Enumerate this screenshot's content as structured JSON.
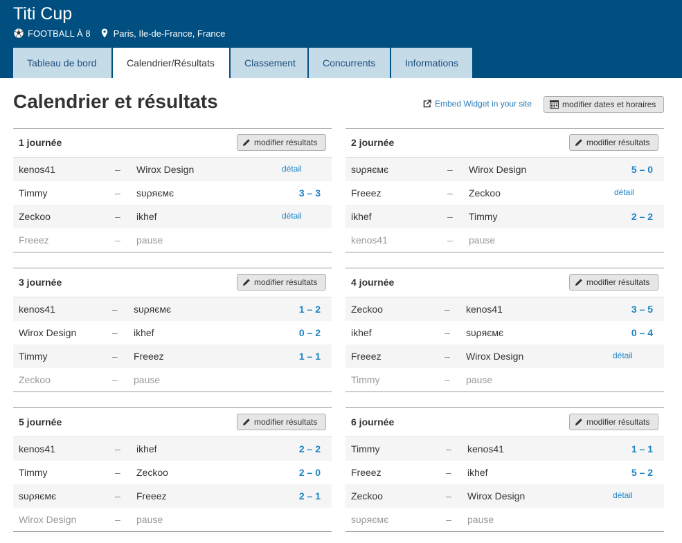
{
  "header": {
    "title": "Titi Cup",
    "sport": "FOOTBALL À 8",
    "location": "Paris, Ile-de-France, France"
  },
  "tabs": [
    {
      "label": "Tableau de bord"
    },
    {
      "label": "Calendrier/Résultats"
    },
    {
      "label": "Classement"
    },
    {
      "label": "Concurrents"
    },
    {
      "label": "Informations"
    }
  ],
  "page": {
    "title": "Calendrier et résultats",
    "embed_label": "Embed Widget in your site",
    "dates_button": "modifier dates et horaires"
  },
  "round_button": "modifier résultats",
  "rounds": [
    {
      "title": "1 journée",
      "matches": [
        {
          "home": "kenos41",
          "dash": "–",
          "away": "Wirox Design",
          "score": "",
          "detail": "détail"
        },
        {
          "home": "Timmy",
          "dash": "–",
          "away": "ѕυρяємє",
          "score": "3 – 3",
          "detail": ""
        },
        {
          "home": "Zeckoo",
          "dash": "–",
          "away": "ikhef",
          "score": "",
          "detail": "détail"
        },
        {
          "home": "Freeez",
          "dash": "–",
          "away": "pause",
          "score": "",
          "detail": ""
        }
      ]
    },
    {
      "title": "2 journée",
      "matches": [
        {
          "home": "ѕυρяємє",
          "dash": "–",
          "away": "Wirox Design",
          "score": "5 – 0",
          "detail": ""
        },
        {
          "home": "Freeez",
          "dash": "–",
          "away": "Zeckoo",
          "score": "",
          "detail": "détail"
        },
        {
          "home": "ikhef",
          "dash": "–",
          "away": "Timmy",
          "score": "2 – 2",
          "detail": ""
        },
        {
          "home": "kenos41",
          "dash": "–",
          "away": "pause",
          "score": "",
          "detail": ""
        }
      ]
    },
    {
      "title": "3 journée",
      "matches": [
        {
          "home": "kenos41",
          "dash": "–",
          "away": "ѕυρяємє",
          "score": "1 – 2",
          "detail": ""
        },
        {
          "home": "Wirox Design",
          "dash": "–",
          "away": "ikhef",
          "score": "0 – 2",
          "detail": ""
        },
        {
          "home": "Timmy",
          "dash": "–",
          "away": "Freeez",
          "score": "1 – 1",
          "detail": ""
        },
        {
          "home": "Zeckoo",
          "dash": "–",
          "away": "pause",
          "score": "",
          "detail": ""
        }
      ]
    },
    {
      "title": "4 journée",
      "matches": [
        {
          "home": "Zeckoo",
          "dash": "–",
          "away": "kenos41",
          "score": "3 – 5",
          "detail": ""
        },
        {
          "home": "ikhef",
          "dash": "–",
          "away": "ѕυρяємє",
          "score": "0 – 4",
          "detail": ""
        },
        {
          "home": "Freeez",
          "dash": "–",
          "away": "Wirox Design",
          "score": "",
          "detail": "détail"
        },
        {
          "home": "Timmy",
          "dash": "–",
          "away": "pause",
          "score": "",
          "detail": ""
        }
      ]
    },
    {
      "title": "5 journée",
      "matches": [
        {
          "home": "kenos41",
          "dash": "–",
          "away": "ikhef",
          "score": "2 – 2",
          "detail": ""
        },
        {
          "home": "Timmy",
          "dash": "–",
          "away": "Zeckoo",
          "score": "2 – 0",
          "detail": ""
        },
        {
          "home": "ѕυρяємє",
          "dash": "–",
          "away": "Freeez",
          "score": "2 – 1",
          "detail": ""
        },
        {
          "home": "Wirox Design",
          "dash": "–",
          "away": "pause",
          "score": "",
          "detail": ""
        }
      ]
    },
    {
      "title": "6 journée",
      "matches": [
        {
          "home": "Timmy",
          "dash": "–",
          "away": "kenos41",
          "score": "1 – 1",
          "detail": ""
        },
        {
          "home": "Freeez",
          "dash": "–",
          "away": "ikhef",
          "score": "5 – 2",
          "detail": ""
        },
        {
          "home": "Zeckoo",
          "dash": "–",
          "away": "Wirox Design",
          "score": "",
          "detail": "détail"
        },
        {
          "home": "ѕυρяємє",
          "dash": "–",
          "away": "pause",
          "score": "",
          "detail": ""
        }
      ]
    }
  ],
  "colors": {
    "header_bg": "#004f80",
    "tab_bg": "#c6dbe8",
    "link": "#1a84c4"
  },
  "icons": {
    "sport": "soccer-ball-icon",
    "location": "map-marker-icon",
    "embed": "external-link-icon",
    "dates": "calendar-icon",
    "edit": "pencil-icon"
  }
}
